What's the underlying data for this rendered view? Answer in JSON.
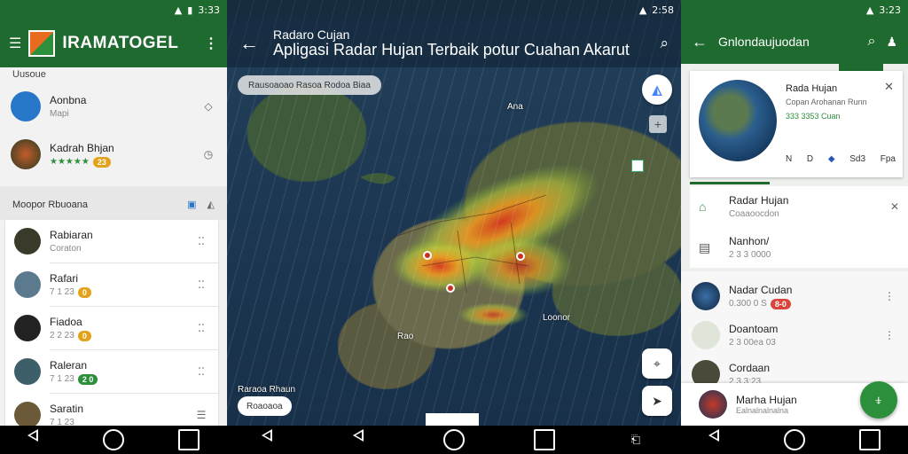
{
  "screen1": {
    "status": "3:33",
    "brand": "IRAMATOGEL",
    "section1": "Uusoue",
    "items_top": [
      {
        "title": "Aonbna",
        "sub": "Mapi"
      },
      {
        "title": "Kadrah Bhjan",
        "sub": "★★★★★",
        "pill": "23"
      }
    ],
    "section2": "Moopor Rbuoana",
    "items_card": [
      {
        "title": "Rabiaran",
        "sub": "Coraton"
      },
      {
        "title": "Rafari",
        "sub": "7 1 23",
        "pill": "0"
      },
      {
        "title": "Fiadoa",
        "sub": "2 2 23",
        "pill": "0"
      },
      {
        "title": "Raleran",
        "sub": "7 1 23",
        "pill": "2 0"
      },
      {
        "title": "Saratin",
        "sub": "7 1 23"
      }
    ]
  },
  "screen2": {
    "status": "2:58",
    "title_a": "Radaro Cujan",
    "title_b": "Apligasi Radar Hujan Terbaik potur Cuahan Akarut",
    "chip": "Rausoaoao Rasoa Rodoa Biaa",
    "labels": [
      "Ana",
      "Loonor",
      "Rao"
    ],
    "bottom_label": "Raraoa Rhaun",
    "bottom_chip": "Roaoaoa"
  },
  "screen3": {
    "status": "3:23",
    "title": "Gnlondaujuodan",
    "detail": {
      "title": "Rada Hujan",
      "sub": "Copan Arohanan Runn",
      "stat": "333 3353 Cuan",
      "icons": [
        "N",
        "D",
        "◆",
        "Sd3",
        "Fpa"
      ]
    },
    "list": [
      {
        "title": "Radar Hujan",
        "sub": "Coaaoocdon"
      },
      {
        "title": "Nanhon/",
        "sub": "2 3 3 0000"
      },
      {
        "title": "Nadar Cudan",
        "sub": "0.300 0 S",
        "pill": "8-0"
      },
      {
        "title": "Doantoam",
        "sub": "2 3 00ea 03"
      },
      {
        "title": "Cordaan",
        "sub": "2 3 3:23"
      }
    ],
    "bottom": {
      "title": "Marha Hujan",
      "sub": "Ealnalnalnalna"
    }
  }
}
